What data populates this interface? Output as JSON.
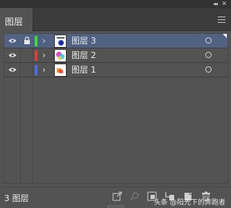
{
  "panel": {
    "tab_label": "图层",
    "collapse_glyph": "◂◂",
    "close_glyph": "✕"
  },
  "layers": [
    {
      "name": "图层 3",
      "selected": true,
      "locked": true,
      "color": "#3ddc3d",
      "thumb": "blue-dot"
    },
    {
      "name": "图层 2",
      "selected": false,
      "locked": false,
      "color": "#e03c3c",
      "thumb": "pink-cyan"
    },
    {
      "name": "图层 1",
      "selected": false,
      "locked": false,
      "color": "#4d6fe6",
      "thumb": "orange-swatch"
    }
  ],
  "footer": {
    "count_label": "3 图层",
    "watermark": "头条 @阳光下的奔跑者"
  },
  "icons": {
    "visibility": "eye-icon",
    "lock": "lock-icon",
    "expand": "chevron-right-icon",
    "target": "target-circle-icon",
    "menu": "hamburger-menu-icon",
    "footer": [
      "export-icon",
      "search-icon",
      "clipping-mask-icon",
      "new-sublayer-icon",
      "new-layer-icon",
      "trash-icon"
    ]
  },
  "colors": {
    "panel_bg": "#535353",
    "selected_row": "#506182",
    "titlebar": "#323232"
  }
}
